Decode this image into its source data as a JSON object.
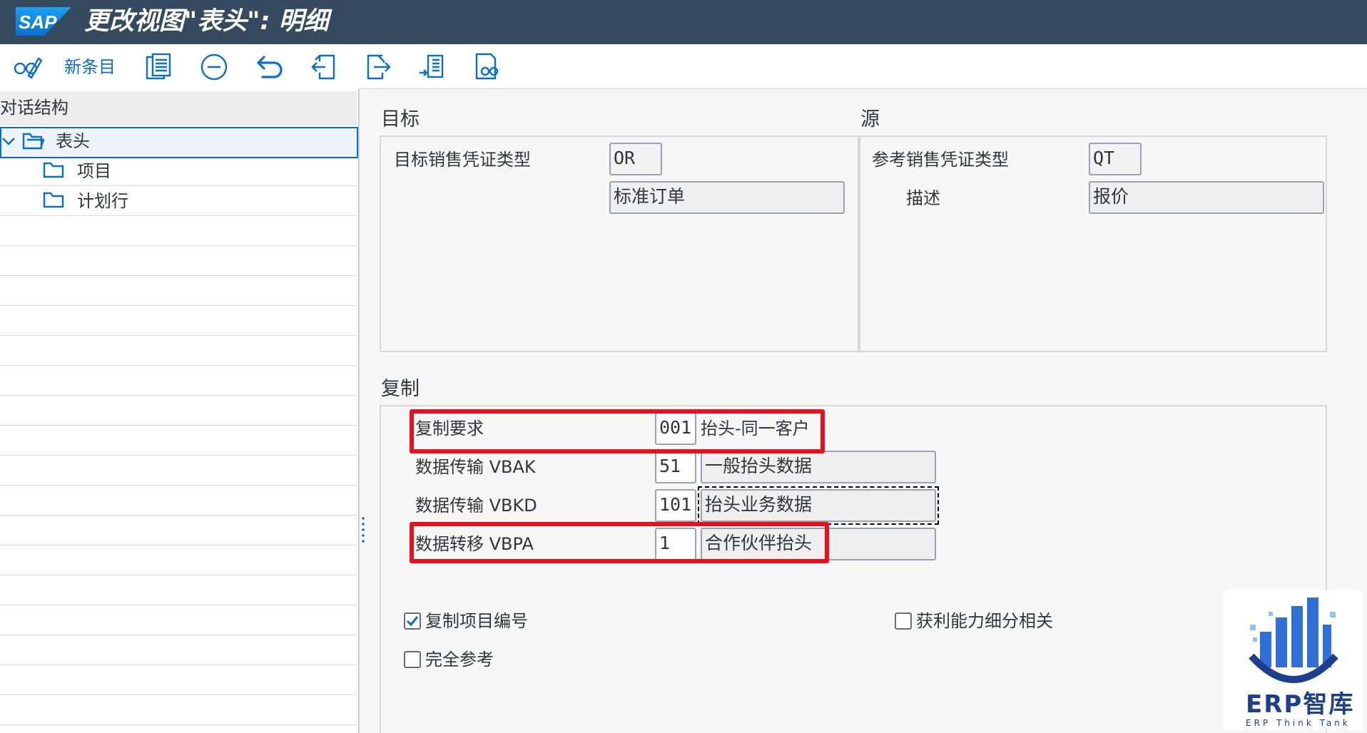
{
  "window": {
    "title": "更改视图\"表头\": 明细",
    "logo_text": "SAP"
  },
  "toolbar": {
    "new_entries_label": "新条目",
    "icons": [
      "display-change-icon",
      "copy-icon",
      "delete-icon",
      "undo-icon",
      "previous-entry-icon",
      "next-entry-icon",
      "select-all-icon",
      "where-used-icon"
    ]
  },
  "tree": {
    "header": "对话结构",
    "items": [
      {
        "label": "表头",
        "icon": "open-folder-icon",
        "selected": true,
        "expanded": true
      },
      {
        "label": "项目",
        "icon": "folder-icon"
      },
      {
        "label": "计划行",
        "icon": "folder-icon"
      }
    ]
  },
  "target": {
    "title": "目标",
    "doc_type_label": "目标销售凭证类型",
    "doc_type_value": "OR",
    "doc_type_desc": "标准订单"
  },
  "source": {
    "title": "源",
    "doc_type_label": "参考销售凭证类型",
    "doc_type_value": "QT",
    "desc_label": "描述",
    "doc_type_desc": "报价"
  },
  "copy": {
    "title": "复制",
    "rows": [
      {
        "label": "复制要求",
        "value": "001",
        "desc": "抬头-同一客户"
      },
      {
        "label": "数据传输 VBAK",
        "value": "51",
        "desc": "一般抬头数据"
      },
      {
        "label": "数据传输 VBKD",
        "value": "101",
        "desc": "抬头业务数据"
      },
      {
        "label": "数据转移 VBPA",
        "value": "1",
        "desc": "合作伙伴抬头"
      }
    ],
    "checkboxes": [
      {
        "label": "复制项目编号",
        "checked": true
      },
      {
        "label": "完全参考",
        "checked": false
      },
      {
        "label": "获利能力细分相关",
        "checked": false
      }
    ]
  },
  "watermark": {
    "text": "ERP智库",
    "subtext": "ERP Think Tank"
  },
  "colors": {
    "titlebar": "#354a5f",
    "accent": "#0a6ed1",
    "highlight": "#e8101c"
  }
}
